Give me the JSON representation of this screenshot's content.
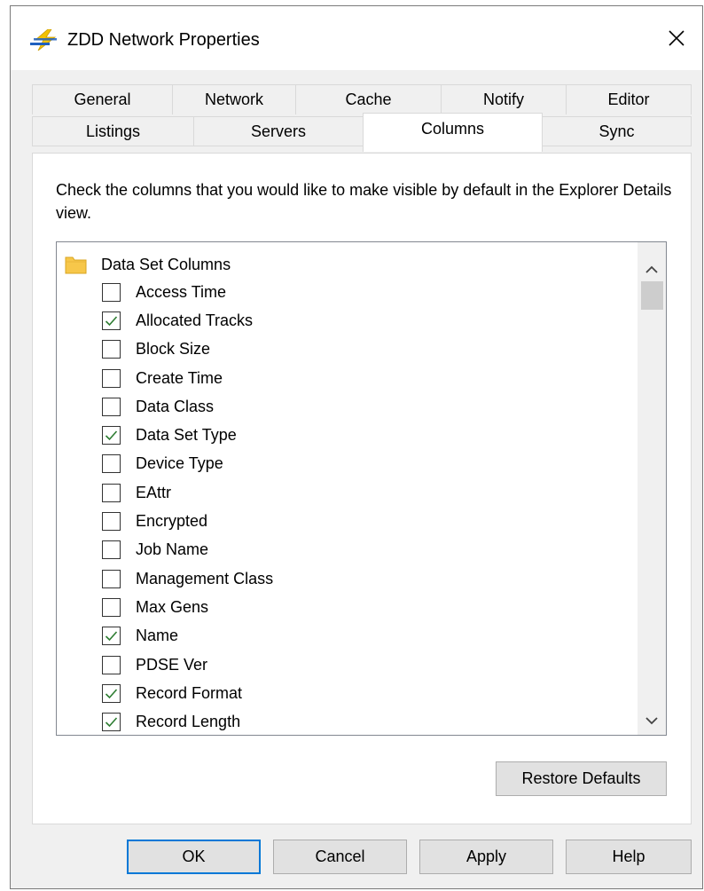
{
  "window": {
    "title": "ZDD Network Properties"
  },
  "tabs": {
    "row1": [
      "General",
      "Network",
      "Cache",
      "Notify",
      "Editor"
    ],
    "row2": [
      "Listings",
      "Servers",
      "Columns",
      "Sync"
    ],
    "active": "Columns"
  },
  "panel": {
    "instructions": "Check the columns that you would like to make visible by default in the Explorer Details view.",
    "tree_root": "Data Set Columns",
    "columns": [
      {
        "label": "Access Time",
        "checked": false
      },
      {
        "label": "Allocated Tracks",
        "checked": true
      },
      {
        "label": "Block Size",
        "checked": false
      },
      {
        "label": "Create Time",
        "checked": false
      },
      {
        "label": "Data Class",
        "checked": false
      },
      {
        "label": "Data Set Type",
        "checked": true
      },
      {
        "label": "Device Type",
        "checked": false
      },
      {
        "label": "EAttr",
        "checked": false
      },
      {
        "label": "Encrypted",
        "checked": false
      },
      {
        "label": "Job Name",
        "checked": false
      },
      {
        "label": "Management Class",
        "checked": false
      },
      {
        "label": "Max Gens",
        "checked": false
      },
      {
        "label": "Name",
        "checked": true
      },
      {
        "label": "PDSE Ver",
        "checked": false
      },
      {
        "label": "Record Format",
        "checked": true
      },
      {
        "label": "Record Length",
        "checked": true
      }
    ],
    "restore_label": "Restore Defaults"
  },
  "buttons": {
    "ok": "OK",
    "cancel": "Cancel",
    "apply": "Apply",
    "help": "Help"
  },
  "colors": {
    "accent": "#0078d7",
    "check": "#2e7d32",
    "folder": "#f7c74a"
  }
}
